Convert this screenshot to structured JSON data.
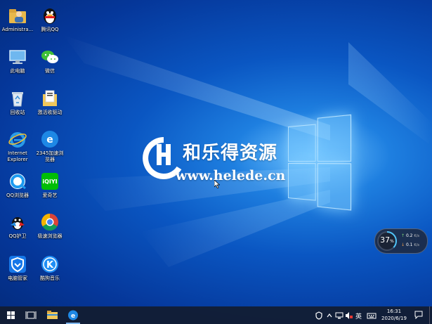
{
  "desktop": {
    "icons": [
      {
        "name": "administrator-folder",
        "label": "Administra..."
      },
      {
        "name": "tencent-qq",
        "label": "腾讯QQ"
      },
      {
        "name": "this-pc",
        "label": "此电脑"
      },
      {
        "name": "wechat",
        "label": "微信"
      },
      {
        "name": "recycle-bin",
        "label": "回收站"
      },
      {
        "name": "driver-activator",
        "label": "激活收驱动"
      },
      {
        "name": "internet-explorer",
        "label": "Internet\nExplorer"
      },
      {
        "name": "browser-2345",
        "label": "2345加速浏\n览器"
      },
      {
        "name": "qq-browser",
        "label": "QQ浏览器"
      },
      {
        "name": "iqiyi",
        "label": "爱奇艺"
      },
      {
        "name": "qq-guard",
        "label": "QQ护卫"
      },
      {
        "name": "speed-browser",
        "label": "极速浏览器"
      },
      {
        "name": "pc-manager",
        "label": "电脑管家"
      },
      {
        "name": "kugou-music",
        "label": "酷狗音乐"
      }
    ]
  },
  "watermark": {
    "title": "和乐得资源",
    "url": "www.helede.cn"
  },
  "network_widget": {
    "percent": "37",
    "percent_unit": "%",
    "upload": "0.2",
    "download": "0.1",
    "unit": "K/s"
  },
  "taskbar": {
    "ime": "英",
    "time": "16:31",
    "date": "2020/6/19"
  },
  "colors": {
    "taskbar_bg": "#121c30",
    "accent": "#0a56c2"
  }
}
